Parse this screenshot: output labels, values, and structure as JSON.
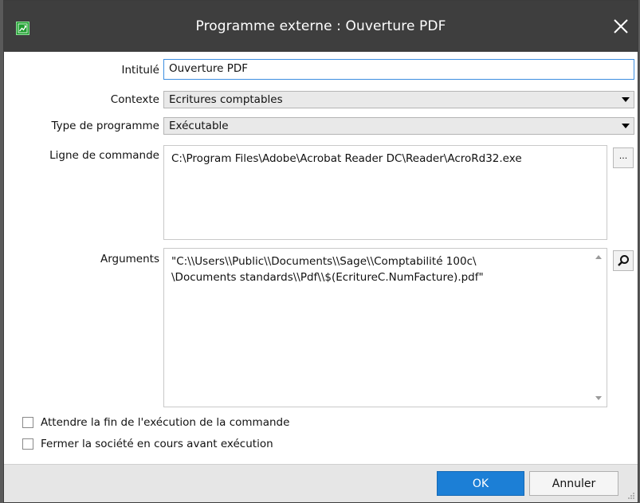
{
  "window": {
    "title": "Programme externe : Ouverture PDF"
  },
  "form": {
    "intitule": {
      "label": "Intitulé",
      "value": "Ouverture PDF"
    },
    "contexte": {
      "label": "Contexte",
      "value": "Ecritures comptables"
    },
    "type_programme": {
      "label": "Type de programme",
      "value": "Exécutable"
    },
    "ligne_commande": {
      "label": "Ligne de commande",
      "value": "C:\\Program Files\\Adobe\\Acrobat Reader DC\\Reader\\AcroRd32.exe",
      "browse_label": "..."
    },
    "arguments": {
      "label": "Arguments",
      "line1": "\"C:\\\\Users\\\\Public\\\\Documents\\\\Sage\\\\Comptabilité 100c\\",
      "line2": "\\Documents standards\\\\Pdf\\\\$(EcritureC.NumFacture).pdf\""
    }
  },
  "options": [
    {
      "label": "Attendre la fin de l'exécution de la commande",
      "checked": false
    },
    {
      "label": "Fermer la société en cours avant exécution",
      "checked": false
    }
  ],
  "footer": {
    "ok_label": "OK",
    "cancel_label": "Annuler"
  },
  "icons": {
    "app": "chart-app-icon",
    "close": "close-icon",
    "browse": "ellipsis-icon",
    "search": "magnifier-icon",
    "dropdown": "chevron-down-icon"
  },
  "colors": {
    "titlebar": "#3e3e3e",
    "accent": "#1c7fd6",
    "focus_border": "#3d8ee0",
    "app_icon": "#1f9d2f"
  }
}
